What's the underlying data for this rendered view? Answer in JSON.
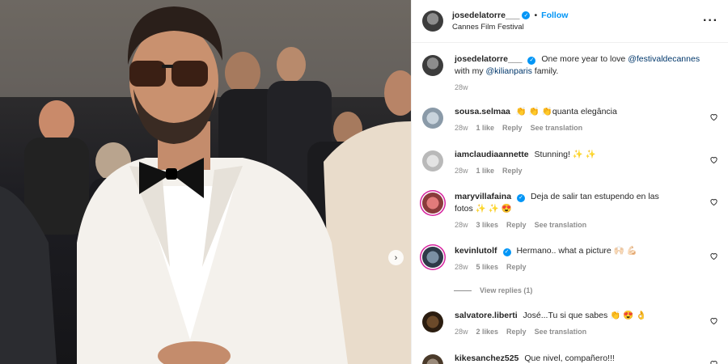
{
  "photo": {
    "next_icon": "chevron-right-icon",
    "next_glyph": "›"
  },
  "header": {
    "username": "josedelatorre___",
    "separator": "•",
    "follow_label": "Follow",
    "location": "Cannes Film Festival",
    "more_glyph": "···",
    "verified_glyph": "✓"
  },
  "caption": {
    "username": "josedelatorre___",
    "text_1": "One more year to love",
    "mention_1": "@festivaldecannes",
    "text_2": "with my",
    "mention_2": "@kilianparis",
    "text_3": "family.",
    "time": "28w"
  },
  "comments": [
    {
      "username": "sousa.selmaa",
      "text": "👏 👏 👏quanta elegância",
      "time": "28w",
      "likes": "1 like",
      "reply": "Reply",
      "translate": "See translation"
    },
    {
      "username": "iamclaudiaannette",
      "text": "Stunning! ✨ ✨",
      "time": "28w",
      "likes": "1 like",
      "reply": "Reply",
      "translate": ""
    },
    {
      "username": "maryvillafaina",
      "text_a": "Deja de salir tan estupendo en las",
      "text_b": "fotos ✨ ✨ 😍",
      "time": "28w",
      "likes": "3 likes",
      "reply": "Reply",
      "translate": "See translation"
    },
    {
      "username": "kevinlutolf",
      "text": "Hermano.. what a picture 🙌🏻 💪🏻",
      "time": "28w",
      "likes": "5 likes",
      "reply": "Reply",
      "translate": ""
    },
    {
      "username": "salvatore.liberti",
      "text": "José...Tu si que sabes 👏 😍 👌",
      "time": "28w",
      "likes": "2 likes",
      "reply": "Reply",
      "translate": "See translation"
    },
    {
      "username": "kikesanchez525",
      "text": "Que nivel, compañero!!!",
      "time": "",
      "likes": "",
      "reply": "",
      "translate": ""
    }
  ],
  "view_replies": "View replies (1)"
}
